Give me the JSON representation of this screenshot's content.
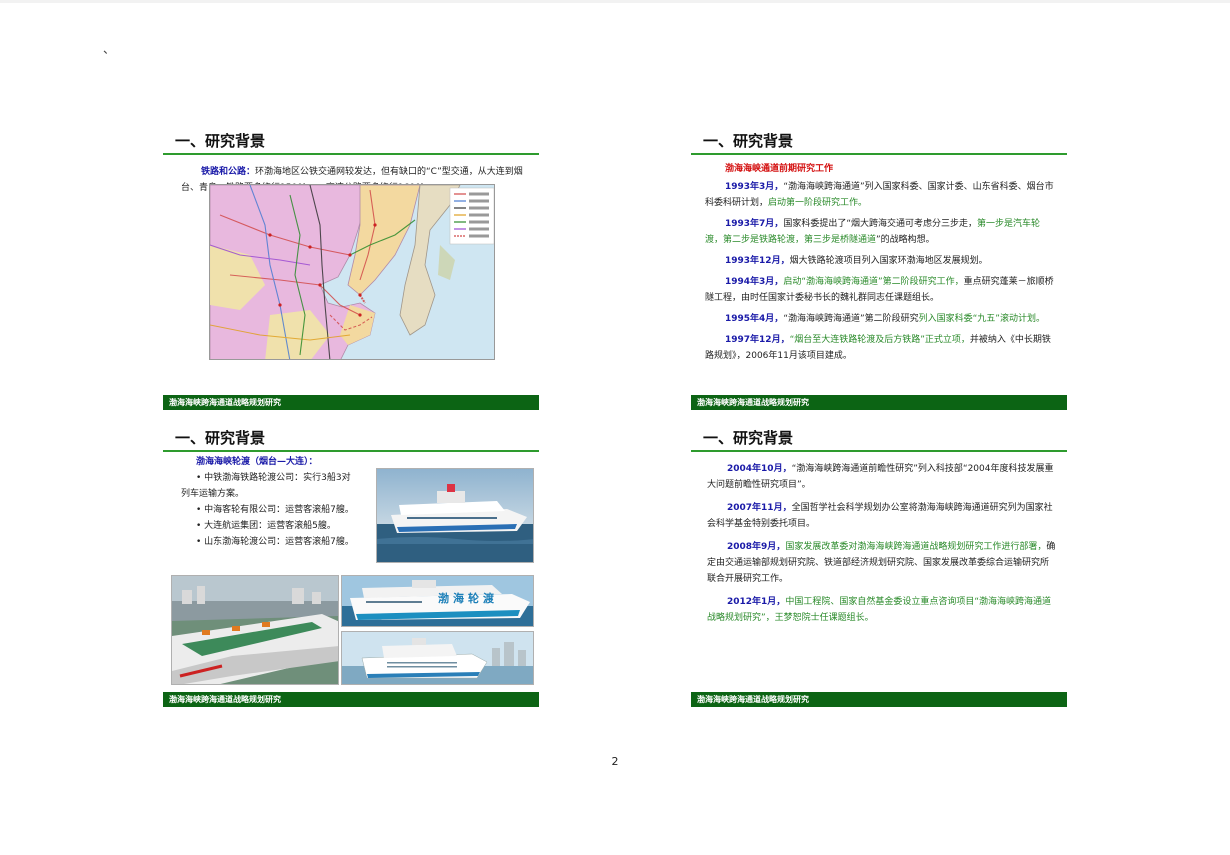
{
  "page": {
    "mark": "、",
    "page_number": "2",
    "footer": "渤海海峡跨海通道战略规划研究"
  },
  "slides": [
    {
      "title": "一、研究背景",
      "lead_label": "铁路和公路：",
      "lead_text": "环渤海地区公铁交通网较发达，但有缺口的“C”型交通，从大连到烟台、青岛，铁路要多绕行1500km，高速公路要多绕行1600km。",
      "footer": "渤海海峡跨海通道战略规划研究"
    },
    {
      "title": "一、研究背景",
      "heading": "渤海海峡通道前期研究工作",
      "entries": [
        {
          "date": "1993年3月，",
          "text": "“渤海海峡跨海通道”列入国家科委、国家计委、山东省科委、烟台市科委科研计划，",
          "green": "启动第一阶段研究工作。",
          "tail": ""
        },
        {
          "date": "1993年7月，",
          "text": "国家科委提出了“烟大跨海交通可考虑分三步走，",
          "green": "第一步是汽车轮渡，第二步是铁路轮渡，第三步是桥隧通道",
          "tail": "”的战略构想。"
        },
        {
          "date": "1993年12月，",
          "text": "烟大铁路轮渡项目列入国家环渤海地区发展规划。",
          "green": "",
          "tail": ""
        },
        {
          "date": "1994年3月，",
          "text": "",
          "green": "启动“渤海海峡跨海通道”第二阶段研究工作，",
          "tail": "重点研究蓬莱－旅顺桥隧工程，由时任国家计委秘书长的魏礼群同志任课题组长。"
        },
        {
          "date": "1995年4月，",
          "text": "“渤海海峡跨海通道”第二阶段研究",
          "green": "列入国家科委“九五”滚动计划。",
          "tail": ""
        },
        {
          "date": "1997年12月，",
          "text": "",
          "green": "“烟台至大连铁路轮渡及后方铁路”正式立项，",
          "tail": "并被纳入《中长期铁路规划》，2006年11月该项目建成。"
        }
      ],
      "footer": "渤海海峡跨海通道战略规划研究"
    },
    {
      "title": "一、研究背景",
      "heading": "渤海海峡轮渡（烟台—大连）：",
      "items": [
        "• 中铁渤海铁路轮渡公司：实行3船3对",
        "列车运输方案。",
        "• 中海客轮有限公司：运营客滚船7艘。",
        "• 大连航运集团：运营客滚船5艘。",
        "• 山东渤海轮渡公司：运营客滚船7艘。"
      ],
      "ship_logo": "渤海轮渡",
      "footer": "渤海海峡跨海通道战略规划研究"
    },
    {
      "title": "一、研究背景",
      "entries": [
        {
          "date": "2004年10月，",
          "text": "“渤海海峡跨海通道前瞻性研究”列入科技部“2004年度科技发展重大问题前瞻性研究项目”。",
          "green": "",
          "tail": ""
        },
        {
          "date": "2007年11月，",
          "text": "全国哲学社会科学规划办公室将渤海海峡跨海通道研究列为国家社会科学基金特别委托项目。",
          "green": "",
          "tail": ""
        },
        {
          "date": "2008年9月，",
          "text": "",
          "green": "国家发展改革委对渤海海峡跨海通道战略规划研究工作进行部署，",
          "tail": "确定由交通运输部规划研究院、铁道部经济规划研究院、国家发展改革委综合运输研究所联合开展研究工作。"
        },
        {
          "date": "2012年1月，",
          "text": "",
          "green": "中国工程院、国家自然基金委设立重点咨询项目“渤海海峡跨海通道战略规划研究”，王梦恕院士任课题组长。",
          "tail": ""
        }
      ],
      "footer": "渤海海峡跨海通道战略规划研究"
    }
  ]
}
